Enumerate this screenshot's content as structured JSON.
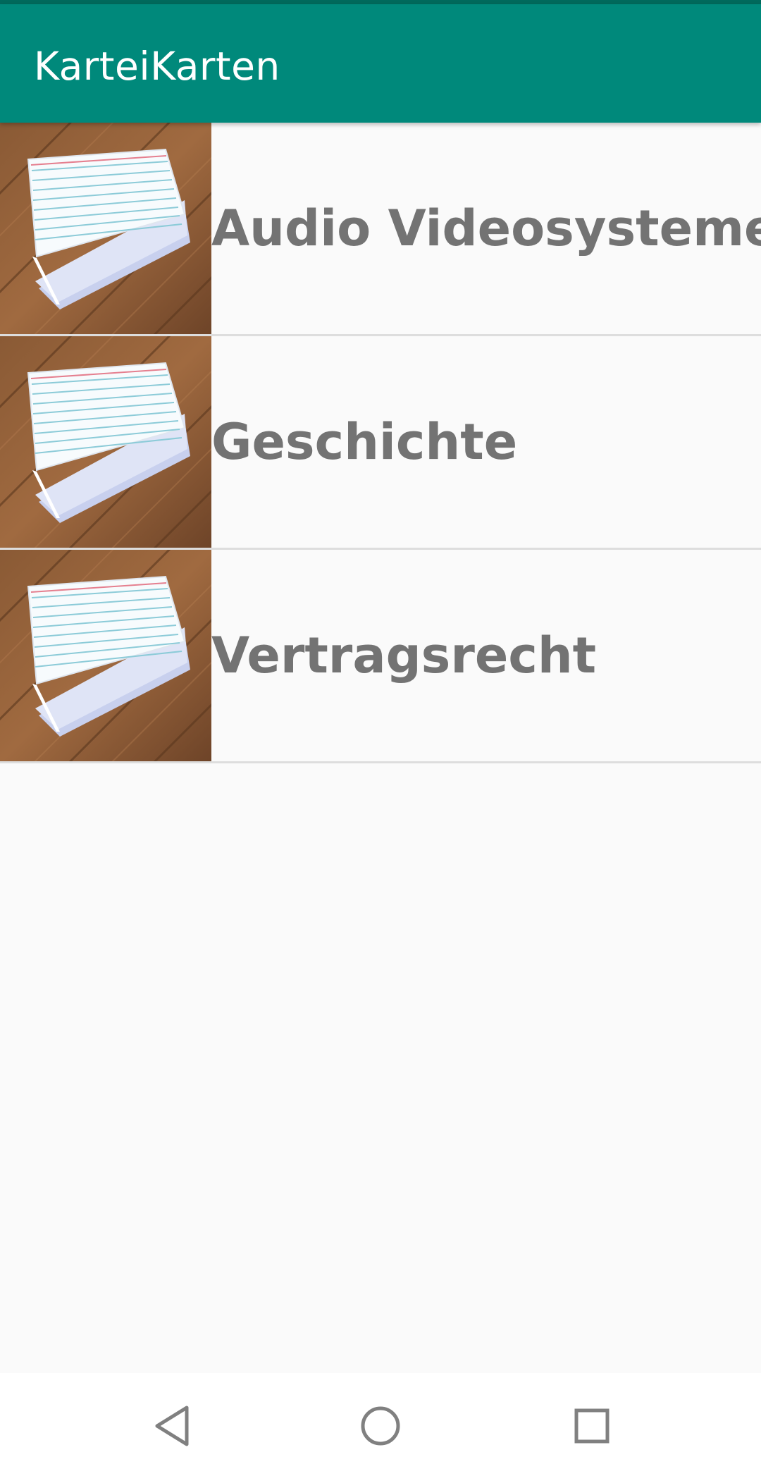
{
  "app": {
    "title": "KarteiKarten",
    "primary_color": "#00897b",
    "status_bar_color": "#00695c"
  },
  "decks": [
    {
      "label": "Audio Videosysteme",
      "thumbnail_icon": "index-cards-image"
    },
    {
      "label": "Geschichte",
      "thumbnail_icon": "index-cards-image"
    },
    {
      "label": "Vertragsrecht",
      "thumbnail_icon": "index-cards-image"
    }
  ],
  "navigation": {
    "back_icon": "back-triangle-icon",
    "home_icon": "home-circle-icon",
    "recents_icon": "recents-square-icon"
  }
}
